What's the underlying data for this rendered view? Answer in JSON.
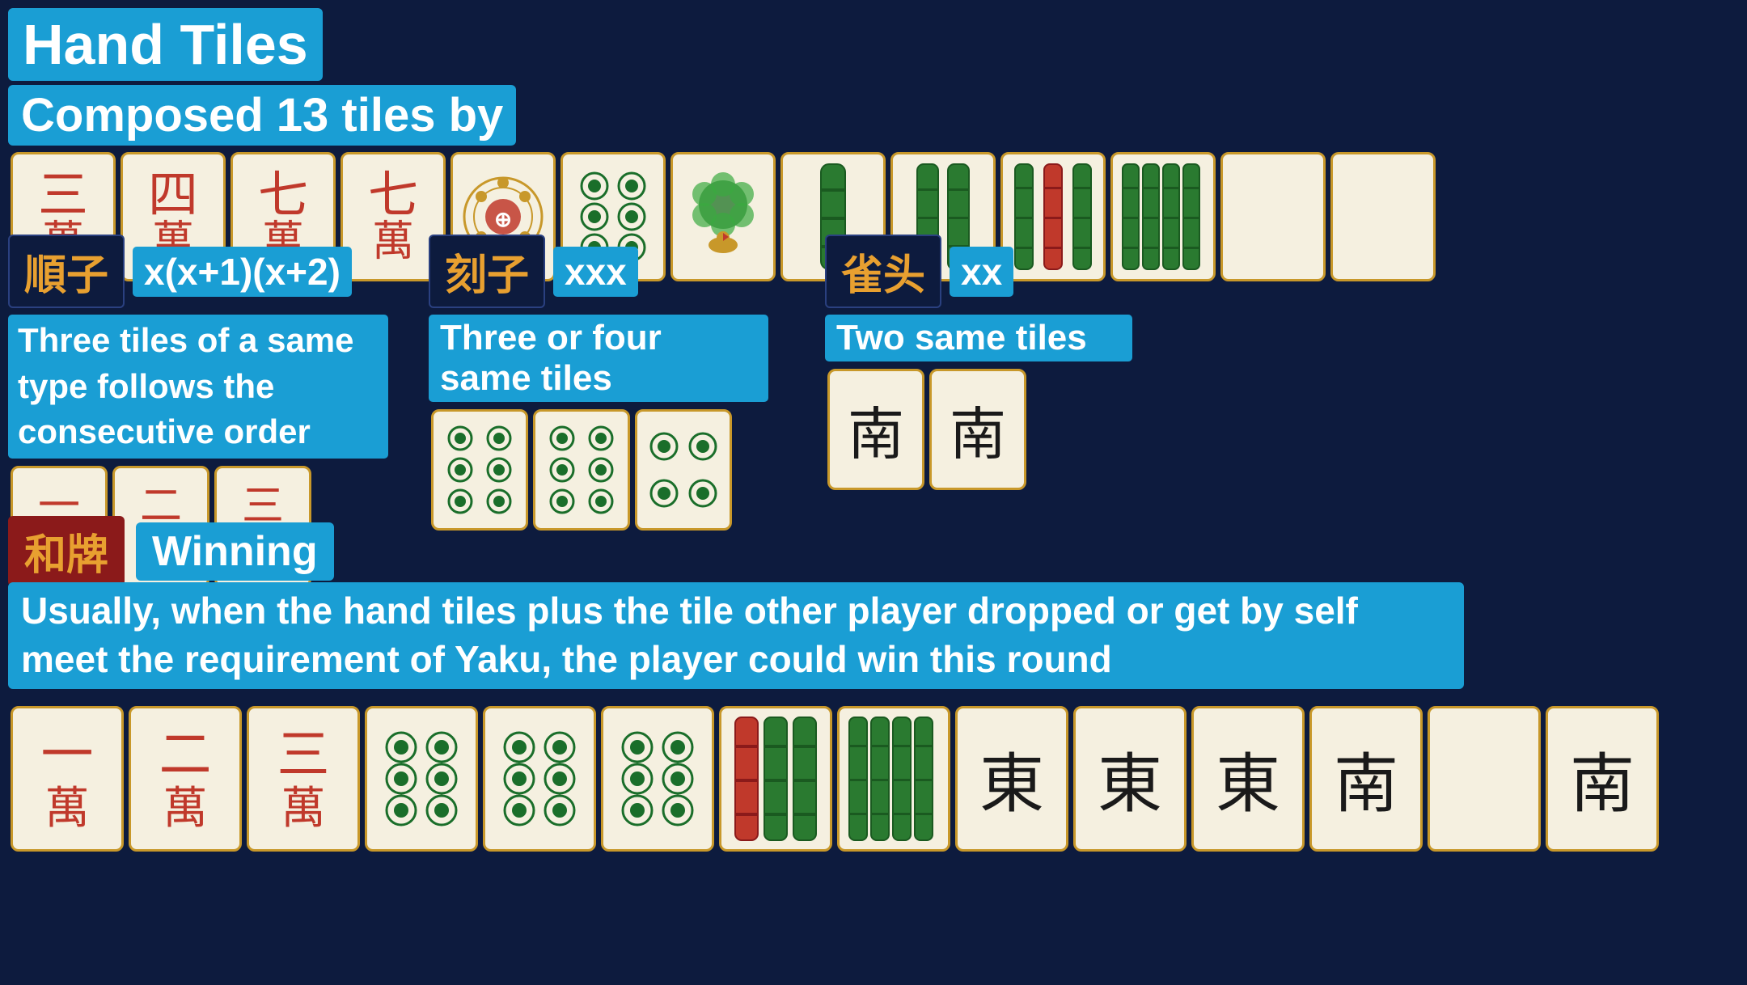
{
  "title": "Hand Tiles",
  "composed_label": "Composed 13 tiles by",
  "sections": {
    "shuntsu": {
      "label": "順子",
      "badge": "x(x+1)(x+2)",
      "desc": "Three tiles of a same type follows the consecutive order",
      "tiles": [
        "一\n萬",
        "二\n萬",
        "三\n萬"
      ]
    },
    "koutsu": {
      "label": "刻子",
      "badge": "xxx",
      "desc": "Three or four same tiles"
    },
    "jantou": {
      "label": "雀头",
      "badge": "xx",
      "desc": "Two same tiles",
      "tiles": [
        "南",
        "南"
      ]
    }
  },
  "winning": {
    "label": "和牌",
    "badge": "Winning",
    "desc": "Usually, when the hand tiles plus the tile other player dropped or get by self meet the requirement of Yaku, the player could win this round"
  },
  "colors": {
    "background": "#0d1b3e",
    "accent_blue": "#1a9ed4",
    "accent_gold": "#e8a030",
    "tile_bg": "#f5f0e0",
    "tile_border": "#c8982a"
  }
}
